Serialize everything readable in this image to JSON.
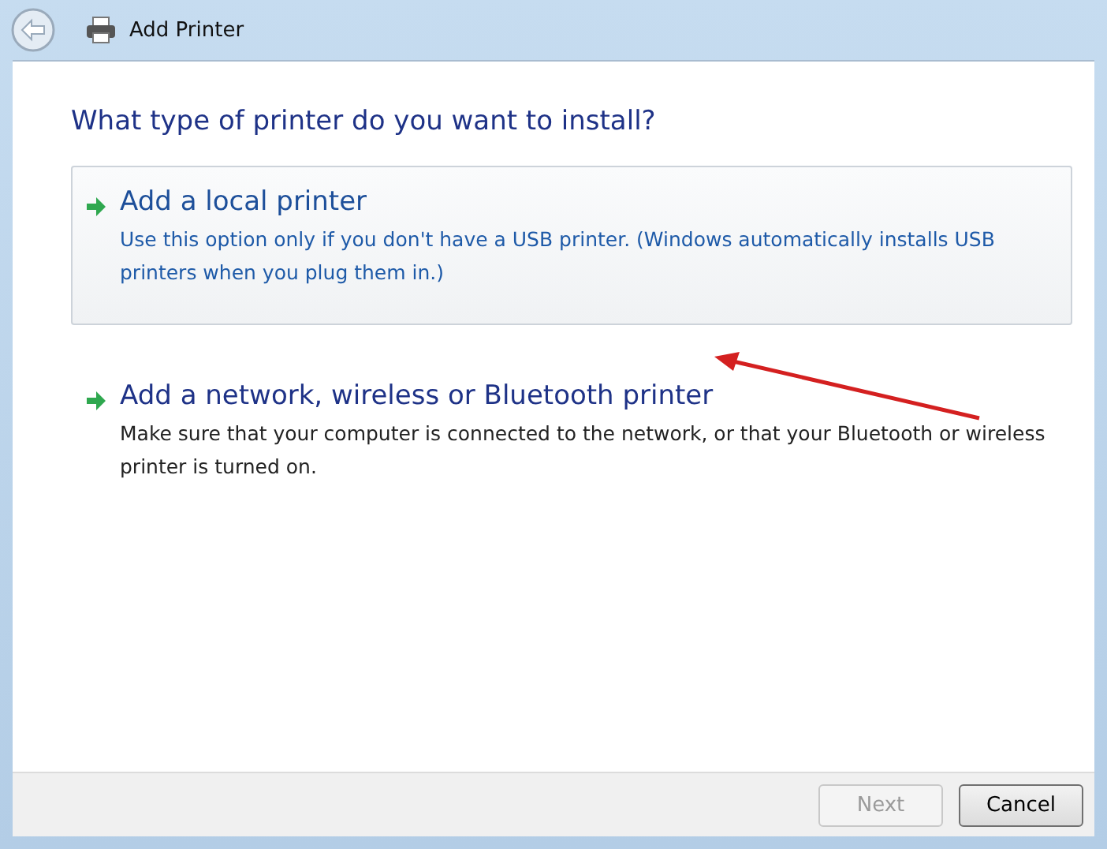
{
  "window": {
    "title": "Add Printer"
  },
  "heading": "What type of printer do you want to install?",
  "options": [
    {
      "title": "Add a local printer",
      "description": "Use this option only if you don't have a USB printer. (Windows automatically installs USB printers when you plug them in.)",
      "selected": true
    },
    {
      "title": "Add a network, wireless or Bluetooth printer",
      "description": "Make sure that your computer is connected to the network, or that your Bluetooth or wireless printer is turned on.",
      "selected": false
    }
  ],
  "buttons": [
    {
      "label": "Next",
      "disabled": true
    },
    {
      "label": "Cancel",
      "disabled": false
    }
  ]
}
